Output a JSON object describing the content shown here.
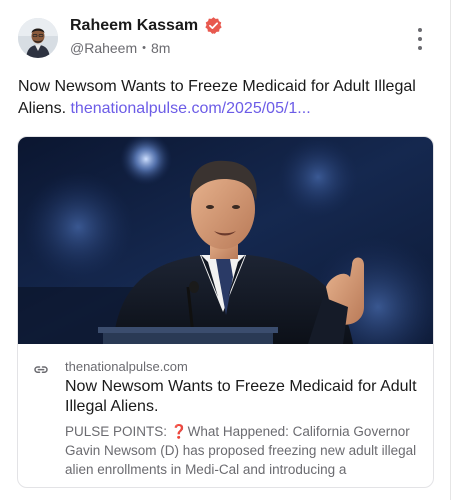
{
  "post": {
    "author": {
      "name": "Raheem Kassam",
      "handle": "@Raheem",
      "separator": "•",
      "time": "8m"
    },
    "text": "Now Newsom Wants to Freeze Medicaid for Adult Illegal Aliens.",
    "link_text": "thenationalpulse.com/2025/05/1..."
  },
  "card": {
    "domain": "thenationalpulse.com",
    "title": "Now Newsom Wants to Freeze Medicaid for Adult Illegal Aliens.",
    "description": "PULSE POINTS: ❓What Happened: California Governor Gavin Newsom (D) has proposed freezing new adult illegal alien enrollments in Medi-Cal and introducing a"
  },
  "colors": {
    "accent": "#6c5ce7",
    "verified_badge": "#e8594f",
    "muted_text": "#6b6b70"
  },
  "icons": {
    "verified": "verified-badge-icon",
    "more": "more-vertical-icon",
    "link": "link-icon"
  }
}
